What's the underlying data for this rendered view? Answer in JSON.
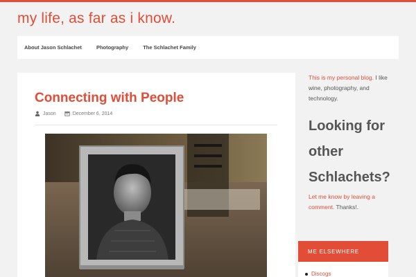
{
  "site": {
    "title": "my life, as far as i know."
  },
  "nav": {
    "items": [
      "About Jason Schlachet",
      "Photography",
      "The Schlachet Family"
    ]
  },
  "post": {
    "title": "Connecting with People",
    "author": "Jason",
    "date": "December 6, 2014",
    "image_alt": "Framed black-and-white portrait photo on a wooden table"
  },
  "sidebar": {
    "intro_link": "This is my personal blog.",
    "intro_rest": " I like wine, photography, and technology.",
    "heading": "Looking for other Schlachets?",
    "contact_link": "Let me know by leaving a comment.",
    "contact_rest": " Thanks!.",
    "widget_title": "ME ELSEWHERE",
    "widget_items": [
      "Discogs"
    ]
  },
  "colors": {
    "accent": "#e14d36",
    "background": "#f2f2f2",
    "panel": "#ffffff"
  }
}
